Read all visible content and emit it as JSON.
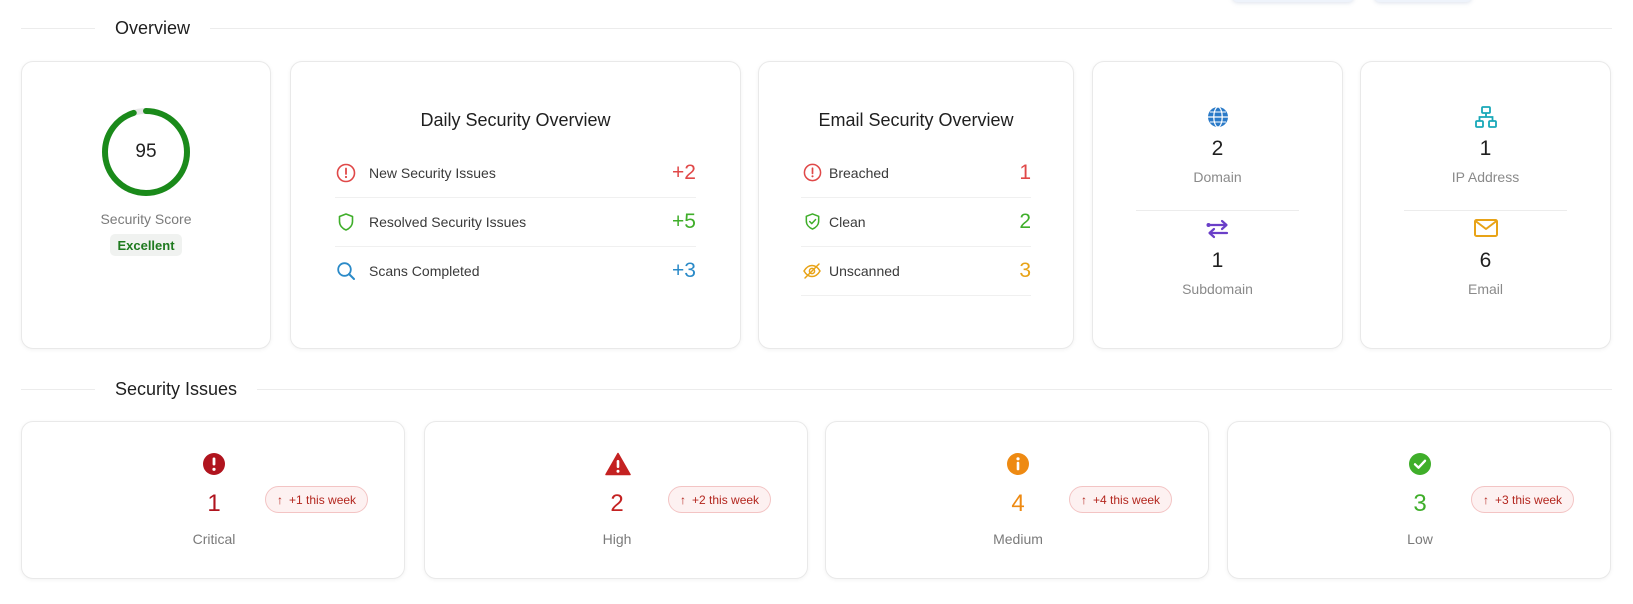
{
  "sections": {
    "overview_title": "Overview",
    "issues_title": "Security Issues"
  },
  "score": {
    "value": "95",
    "percent": 95,
    "label": "Security Score",
    "rating": "Excellent",
    "color": "#1a8a1a"
  },
  "daily": {
    "title": "Daily Security Overview",
    "rows": [
      {
        "label": "New Security Issues",
        "value": "+2",
        "icon": "alert-circle-icon",
        "color": "#e04848"
      },
      {
        "label": "Resolved Security Issues",
        "value": "+5",
        "icon": "shield-icon",
        "color": "#3fae2a"
      },
      {
        "label": "Scans Completed",
        "value": "+3",
        "icon": "search-icon",
        "color": "#2a8ac8"
      }
    ]
  },
  "email": {
    "title": "Email Security Overview",
    "rows": [
      {
        "label": "Breached",
        "value": "1",
        "icon": "alert-circle-icon",
        "color": "#e04848"
      },
      {
        "label": "Clean",
        "value": "2",
        "icon": "shield-check-icon",
        "color": "#3fae2a"
      },
      {
        "label": "Unscanned",
        "value": "3",
        "icon": "eye-off-icon",
        "color": "#e8a317"
      }
    ]
  },
  "assets": {
    "domain": {
      "count": "2",
      "label": "Domain",
      "icon": "globe-icon",
      "color": "#2a7ac8"
    },
    "subdomain": {
      "count": "1",
      "label": "Subdomain",
      "icon": "swap-arrows-icon",
      "color": "#6a3fc8"
    },
    "ip": {
      "count": "1",
      "label": "IP Address",
      "icon": "network-icon",
      "color": "#17a8b8"
    },
    "email": {
      "count": "6",
      "label": "Email",
      "icon": "mail-icon",
      "color": "#e8a317"
    }
  },
  "issues": [
    {
      "count": "1",
      "label": "Critical",
      "week": "+1 this week",
      "icon": "critical-circle-icon",
      "color": "#b0141e"
    },
    {
      "count": "2",
      "label": "High",
      "week": "+2 this week",
      "icon": "warning-triangle-icon",
      "color": "#c42222"
    },
    {
      "count": "4",
      "label": "Medium",
      "week": "+4 this week",
      "icon": "info-circle-icon",
      "color": "#ee8a12"
    },
    {
      "count": "3",
      "label": "Low",
      "week": "+3 this week",
      "icon": "check-circle-icon",
      "color": "#3fae2a"
    }
  ]
}
